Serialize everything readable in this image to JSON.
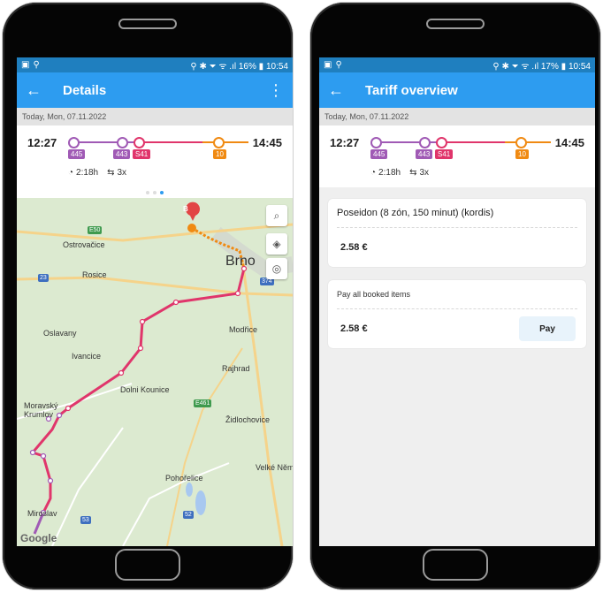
{
  "left_phone": {
    "status": {
      "time": "10:54",
      "battery": "16%"
    },
    "appbar": {
      "back": "←",
      "title": "Details",
      "more": "⋮"
    },
    "date": "Today, Mon, 07.11.2022",
    "trip": {
      "departure": "12:27",
      "arrival": "14:45",
      "badges": [
        "445",
        "443",
        "S41",
        "10"
      ],
      "duration": "2:18h",
      "transfers": "3x"
    },
    "map": {
      "labels": [
        "Ostrovačice",
        "Brno",
        "Rosice",
        "Oslavany",
        "Ivancice",
        "Modřice",
        "Rajhrad",
        "Dolni Kounice",
        "Moravský Krumlov",
        "Židlochovice",
        "Pohořelice",
        "Velké Něm",
        "Miroslav"
      ],
      "road_badges": [
        "E50",
        "23",
        "374",
        "E461",
        "53",
        "52"
      ],
      "google": "Google",
      "marker": "B"
    }
  },
  "right_phone": {
    "status": {
      "time": "10:54",
      "battery": "17%"
    },
    "appbar": {
      "back": "←",
      "title": "Tariff overview"
    },
    "date": "Today, Mon, 07.11.2022",
    "trip": {
      "departure": "12:27",
      "arrival": "14:45",
      "badges": [
        "445",
        "443",
        "S41",
        "10"
      ],
      "duration": "2:18h",
      "transfers": "3x"
    },
    "ticket": {
      "name": "Poseidon (8 zón, 150 minut) (kordis)",
      "price": "2.58 €"
    },
    "pay_all": {
      "label": "Pay all booked items",
      "price": "2.58 €",
      "button": "Pay"
    }
  },
  "colors": {
    "appbar": "#2d9cf0",
    "statusbar": "#1f7fbf",
    "bus_line": "#a05ab5",
    "rail_line": "#e0356b",
    "tram_line": "#f08a12"
  }
}
